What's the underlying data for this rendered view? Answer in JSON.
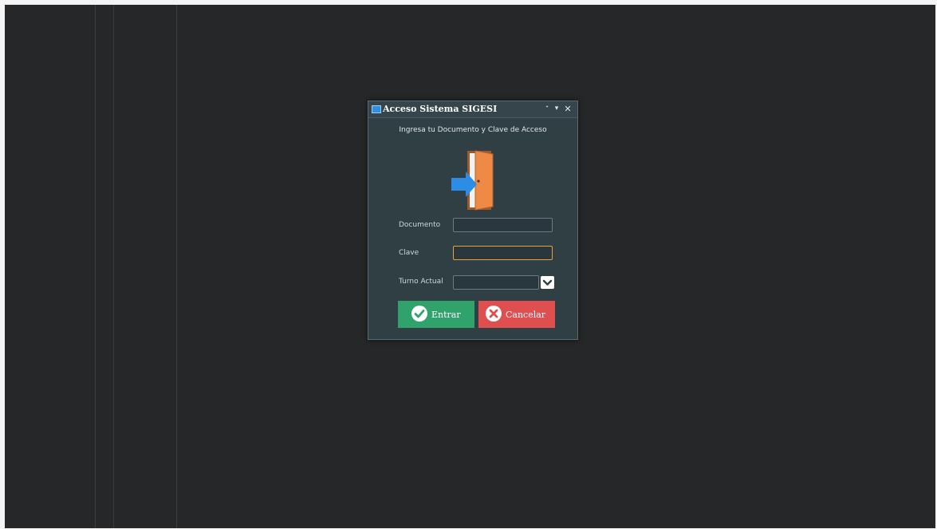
{
  "window": {
    "title": "Acceso Sistema SIGESI",
    "controls": {
      "pin": "ᐩ",
      "dropdown": "▾",
      "close": "✕"
    }
  },
  "dialog": {
    "subtitle": "Ingresa tu Documento y Clave de Acceso",
    "illustration_icon": "door-enter-icon"
  },
  "form": {
    "documento": {
      "label": "Documento",
      "value": "",
      "placeholder": ""
    },
    "clave": {
      "label": "Clave",
      "value": "",
      "placeholder": ""
    },
    "turno": {
      "label": "Turno Actual",
      "selected": ""
    }
  },
  "buttons": {
    "enter": {
      "label": "Entrar",
      "icon": "check-circle-icon"
    },
    "cancel": {
      "label": "Cancelar",
      "icon": "x-circle-icon"
    }
  },
  "colors": {
    "desktop": "#262728",
    "dialog": "#2f3f44",
    "enter": "#2fa36b",
    "cancel": "#e04f4f",
    "focus": "#e8a040",
    "door": "#ee8a45",
    "arrow": "#2b8de6"
  }
}
